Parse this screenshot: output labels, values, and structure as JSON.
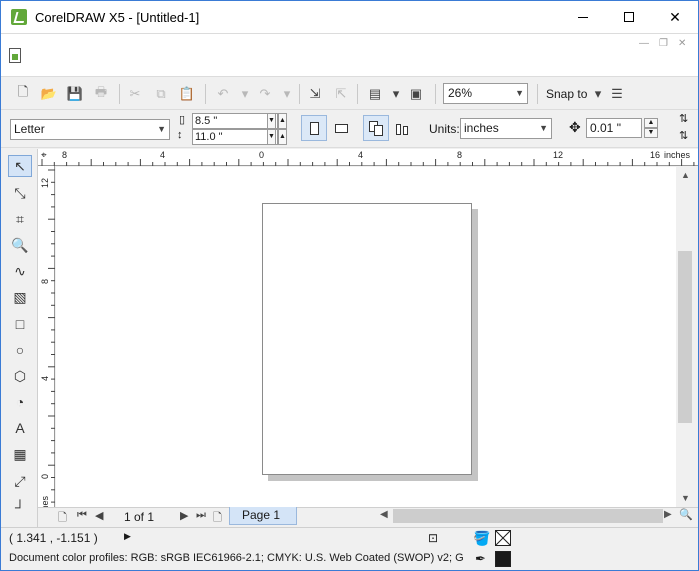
{
  "window": {
    "title": "CorelDRAW X5 - [Untitled-1]",
    "controls": {
      "minimize": "minimize-icon",
      "maximize": "maximize-icon",
      "close": "close-icon"
    }
  },
  "toolbar": {
    "zoom_value": "26%",
    "snap_label": "Snap to",
    "icons": [
      "new-icon",
      "open-icon",
      "save-icon",
      "print-icon",
      "cut-icon",
      "copy-icon",
      "paste-icon",
      "undo-icon",
      "redo-icon",
      "import-icon",
      "export-icon",
      "launcher-icon",
      "welcome-icon"
    ]
  },
  "property_bar": {
    "paper_size": "Letter",
    "width": "8.5 \"",
    "height": "11.0 \"",
    "units_label": "Units:",
    "units_value": "inches",
    "nudge_value": "0.01 \""
  },
  "rulers": {
    "horizontal_ticks": [
      "8",
      "4",
      "0",
      "4",
      "8",
      "12",
      "16"
    ],
    "horizontal_unit": "inches",
    "vertical_ticks": [
      "12",
      "8",
      "4",
      "0"
    ],
    "vertical_unit": "inches"
  },
  "navigator": {
    "page_count": "1 of 1",
    "page_tab": "Page 1"
  },
  "status": {
    "coordinates": "( 1.341 , -1.151 )",
    "color_profiles": "Document color profiles: RGB: sRGB IEC61966-2.1; CMYK: U.S. Web Coated (SWOP) v2; Gr..."
  },
  "colors": {
    "accent": "#3a7bd5",
    "active_tool_bg": "#d4e4f7",
    "page_shadow": "#c4c4c4"
  }
}
